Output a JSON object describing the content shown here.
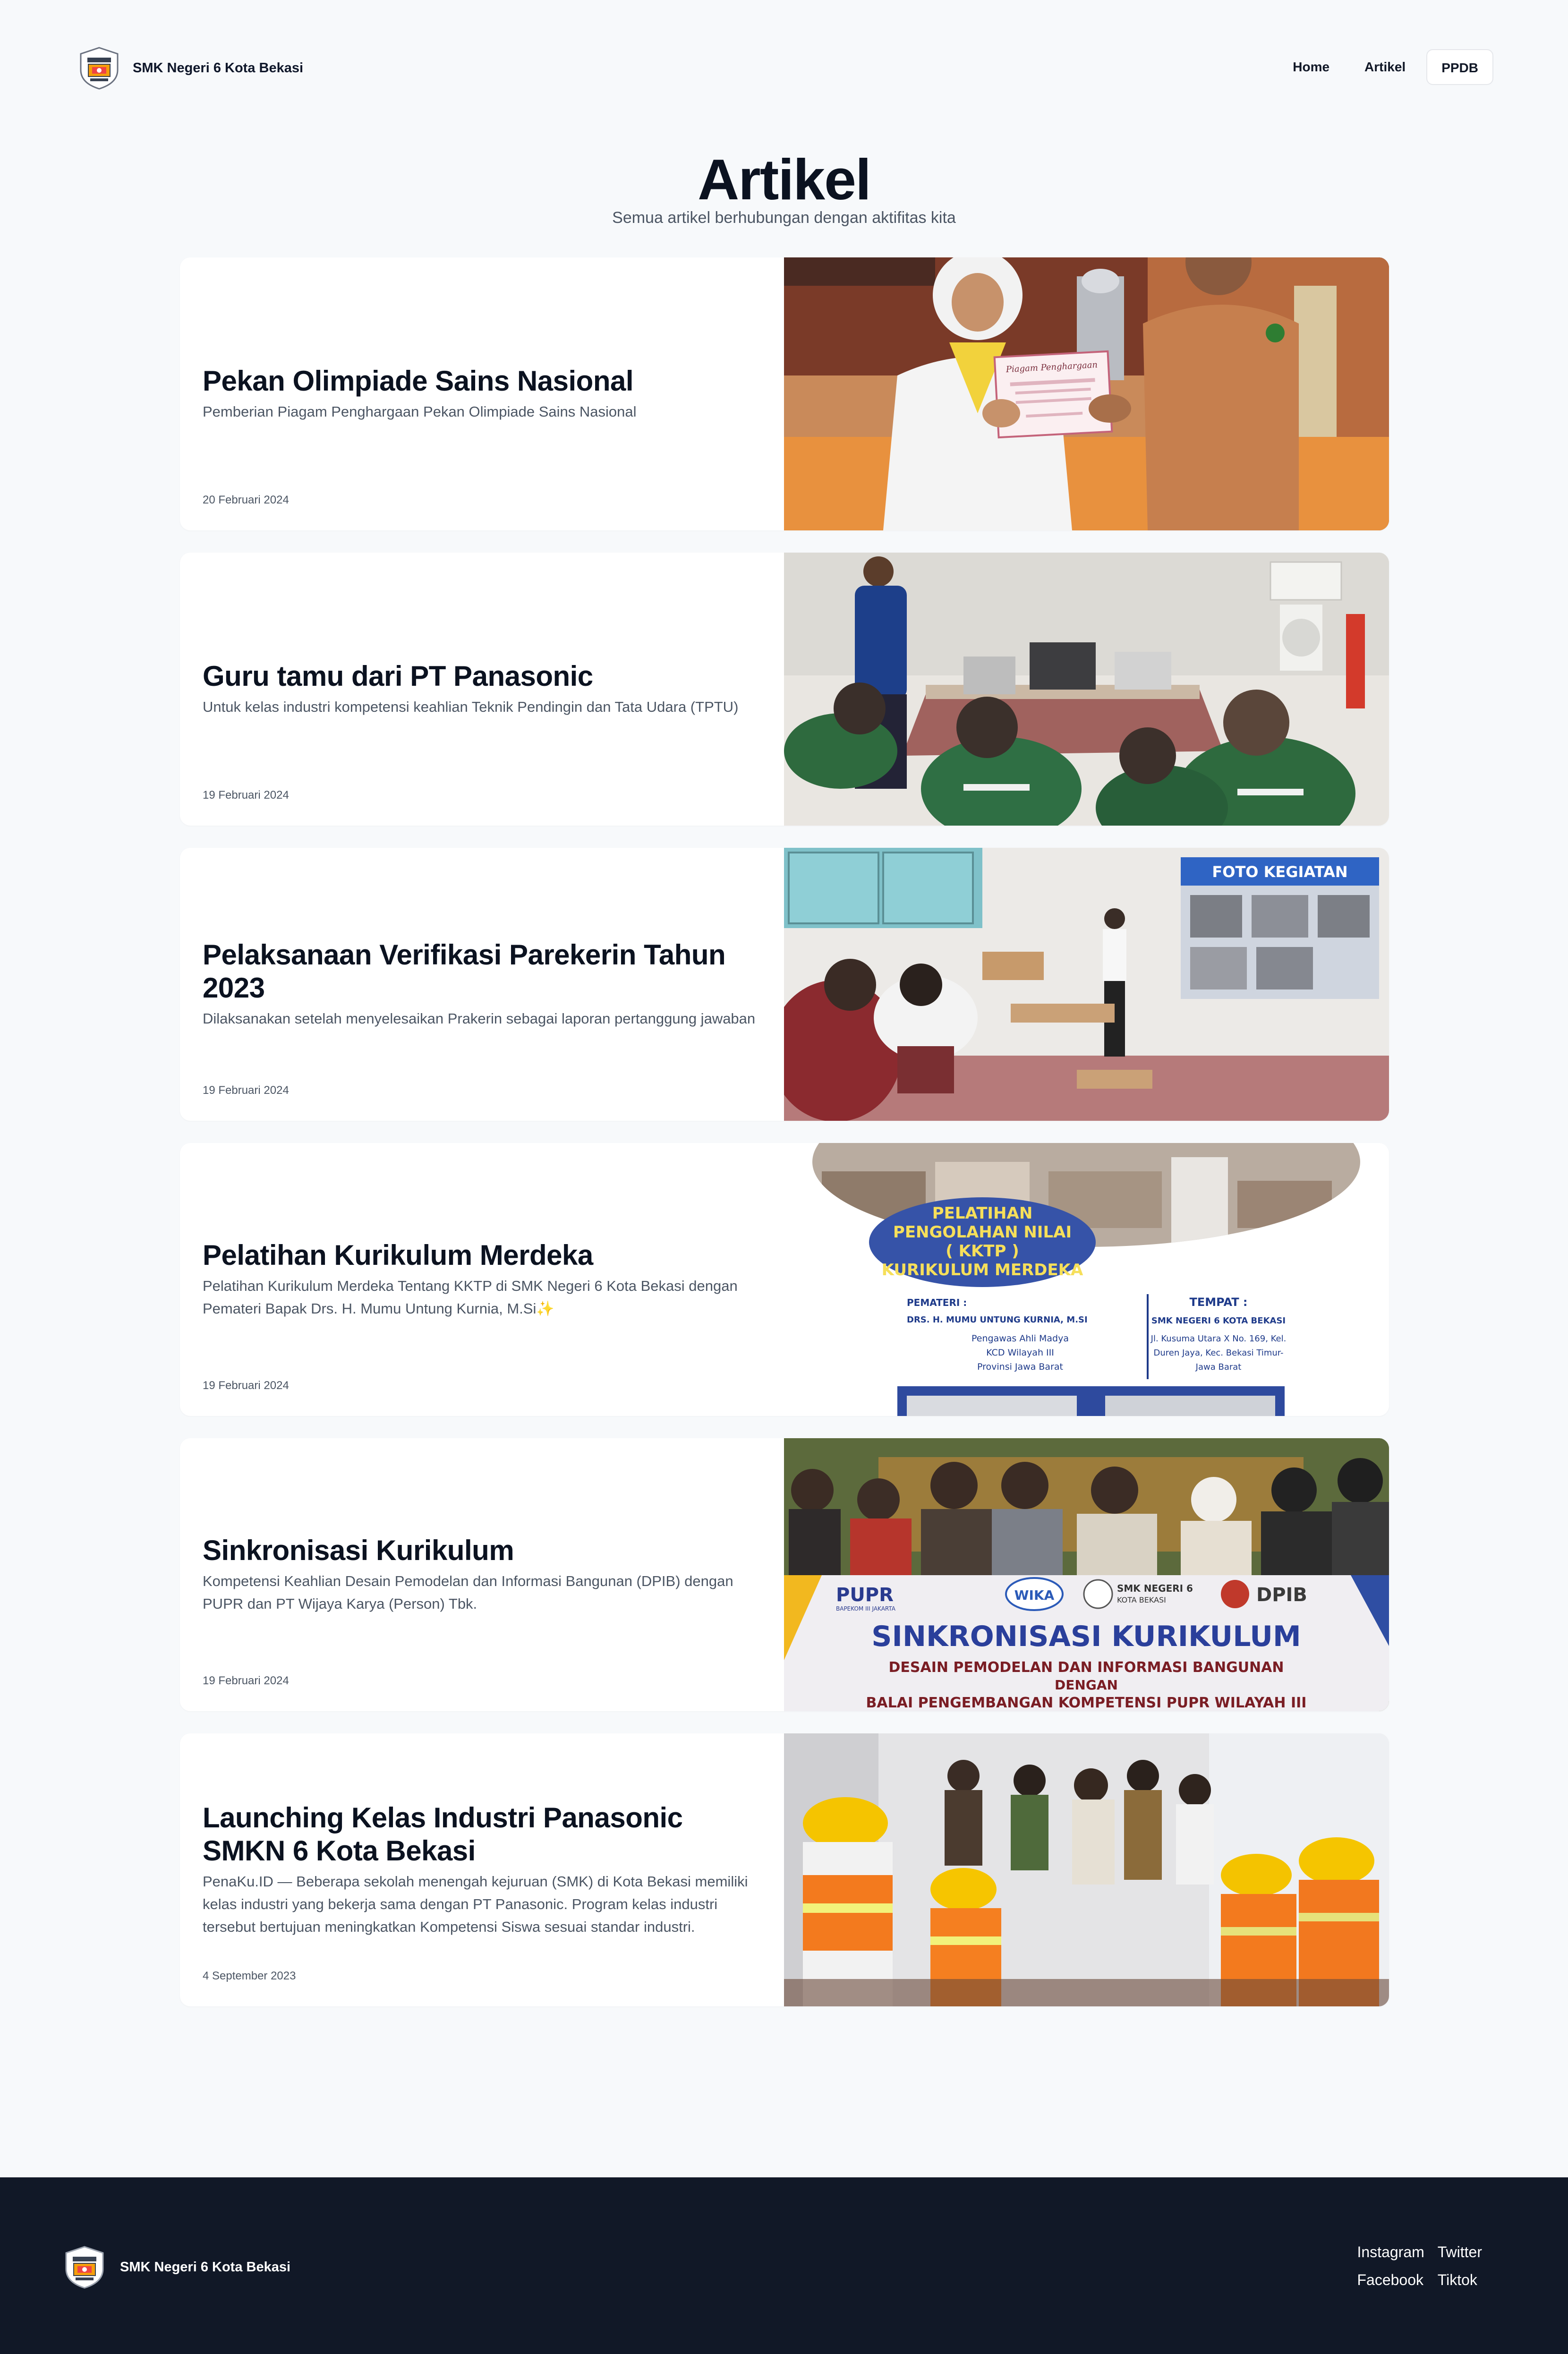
{
  "header": {
    "brand_name": "SMK Negeri 6 Kota Bekasi",
    "nav": [
      {
        "label": "Home"
      },
      {
        "label": "Artikel"
      },
      {
        "label": "PPDB"
      }
    ]
  },
  "page": {
    "title": "Artikel",
    "subtitle": "Semua artikel berhubungan dengan aktifitas kita"
  },
  "articles": [
    {
      "title": "Pekan Olimpiade Sains Nasional",
      "description": "Pemberian Piagam Penghargaan Pekan Olimpiade Sains Nasional",
      "date": "20 Februari 2024",
      "image_text": "Piagam Penghargaan"
    },
    {
      "title": "Guru tamu dari PT Panasonic",
      "description": "Untuk kelas industri kompetensi keahlian Teknik Pendingin dan Tata Udara (TPTU)",
      "date": "19 Februari 2024"
    },
    {
      "title": "Pelaksanaan Verifikasi Parekerin Tahun 2023",
      "description": "Dilaksanakan setelah menyelesaikan Prakerin sebagai laporan pertanggung jawaban",
      "date": "19 Februari 2024",
      "image_text": "FOTO KEGIATAN"
    },
    {
      "title": "Pelatihan Kurikulum Merdeka",
      "description": "Pelatihan Kurikulum Merdeka Tentang KKTP di SMK Negeri 6 Kota Bekasi dengan Pemateri Bapak Drs. H. Mumu Untung Kurnia, M.Si✨",
      "date": "19 Februari 2024",
      "poster": {
        "line1": "PELATIHAN",
        "line2": "PENGOLAHAN NILAI",
        "line3": "( KKTP )",
        "line4": "KURIKULUM MERDEKA",
        "pemateri_label": "PEMATERI :",
        "pemateri_name": "DRS. H. MUMU UNTUNG KURNIA, M.SI",
        "pemateri_role1": "Pengawas Ahli Madya",
        "pemateri_role2": "KCD Wilayah III",
        "pemateri_role3": "Provinsi Jawa Barat",
        "tempat_label": "TEMPAT :",
        "tempat_name": "SMK NEGERI 6 KOTA BEKASI",
        "tempat_addr1": "Jl. Kusuma Utara X No. 169, Kel.",
        "tempat_addr2": "Duren Jaya, Kec. Bekasi Timur-",
        "tempat_addr3": "Jawa Barat"
      }
    },
    {
      "title": "Sinkronisasi Kurikulum",
      "description": "Kompetensi Keahlian Desain Pemodelan dan Informasi Bangunan (DPIB) dengan PUPR dan PT Wijaya Karya (Person) Tbk.",
      "date": "19 Februari 2024",
      "banner": {
        "headline": "SINKRONISASI KURIKULUM",
        "line2": "DESAIN PEMODELAN DAN INFORMASI BANGUNAN",
        "line3": "DENGAN",
        "line4": "BALAI PENGEMBANGAN KOMPETENSI PUPR WILAYAH III",
        "logo1": "PUPR",
        "logo1_sub": "BAPEKOM III JAKARTA",
        "logo2": "WIKA",
        "logo3a": "SMK NEGERI 6",
        "logo3b": "KOTA BEKASI",
        "logo4": "DPIB"
      }
    },
    {
      "title": "Launching Kelas Industri Panasonic SMKN 6 Kota Bekasi",
      "description": "PenaKu.ID — Beberapa sekolah menengah kejuruan (SMK) di Kota Bekasi memiliki kelas industri yang bekerja sama dengan PT Panasonic. Program kelas industri tersebut bertujuan meningkatkan Kompetensi Siswa sesuai standar industri.",
      "date": "4 September 2023"
    }
  ],
  "footer": {
    "brand_name": "SMK Negeri 6 Kota Bekasi",
    "links": [
      {
        "label": "Instagram"
      },
      {
        "label": "Twitter"
      },
      {
        "label": "Facebook"
      },
      {
        "label": "Tiktok"
      }
    ]
  },
  "colors": {
    "background": "#f7f9fb",
    "card": "#ffffff",
    "footer": "#111827",
    "text_primary": "#0b1220",
    "text_secondary": "#4b5563"
  }
}
